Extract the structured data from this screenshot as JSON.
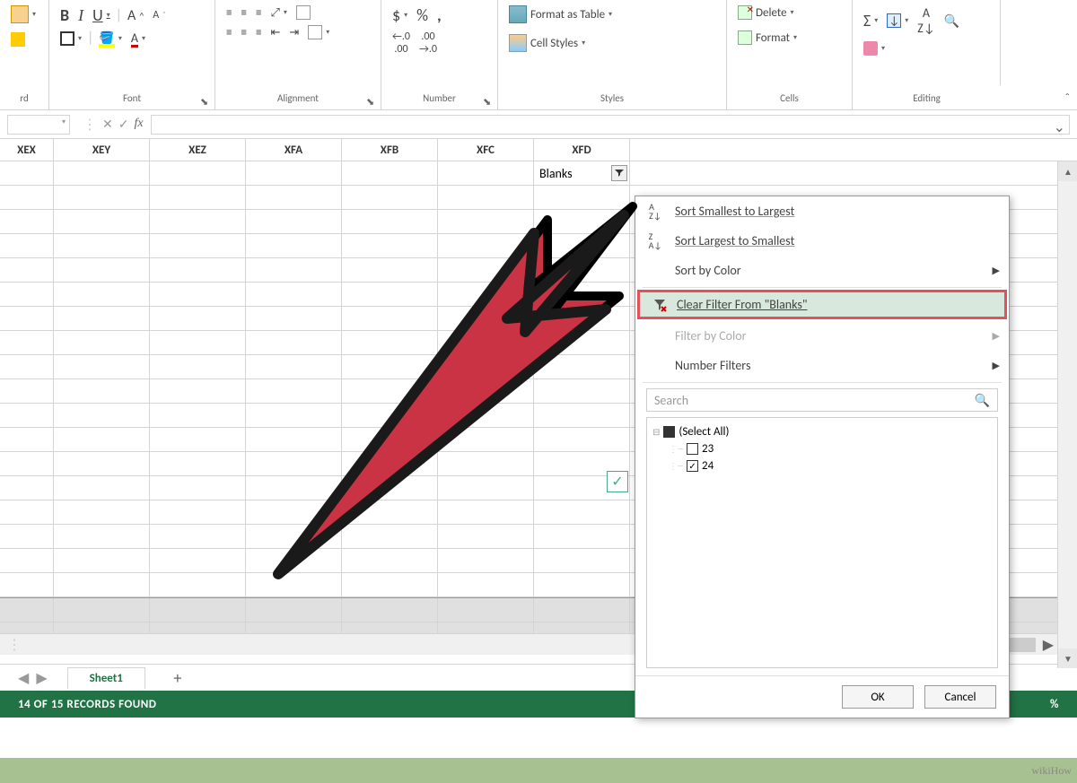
{
  "ribbon": {
    "clipboard": {
      "label": "rd"
    },
    "font": {
      "label": "Font",
      "bold": "B",
      "italic": "I",
      "underline": "U",
      "grow": "A",
      "shrink": "A"
    },
    "alignment": {
      "label": "Alignment"
    },
    "number": {
      "label": "Number",
      "currency": "$",
      "percent": "%",
      "comma": ",",
      "inc": ".0",
      "dec": ".00"
    },
    "styles": {
      "label": "Styles",
      "format_table": "Format as Table",
      "cell_styles": "Cell Styles"
    },
    "cells": {
      "label": "Cells",
      "delete": "Delete",
      "format": "Format"
    },
    "editing": {
      "label": "Editing"
    }
  },
  "formula_bar": {
    "fx": "fx"
  },
  "columns": [
    "XEX",
    "XEY",
    "XEZ",
    "XFA",
    "XFB",
    "XFC",
    "XFD"
  ],
  "filter_cell": {
    "label": "Blanks"
  },
  "filter_menu": {
    "sort_asc": "Sort Smallest to Largest",
    "sort_desc": "Sort Largest to Smallest",
    "sort_color": "Sort by Color",
    "clear": "Clear Filter From \"Blanks\"",
    "filter_color": "Filter by Color",
    "number_filters": "Number Filters",
    "search_placeholder": "Search",
    "select_all": "(Select All)",
    "items": [
      "23",
      "24"
    ],
    "ok": "OK",
    "cancel": "Cancel",
    "az": "A↓Z",
    "za": "Z↓A"
  },
  "sheet_tabs": {
    "active": "Sheet1",
    "new": "+"
  },
  "status_bar": {
    "records": "14 OF 15 RECORDS FOUND",
    "zoom": "%"
  },
  "watermark": "wikiHow"
}
